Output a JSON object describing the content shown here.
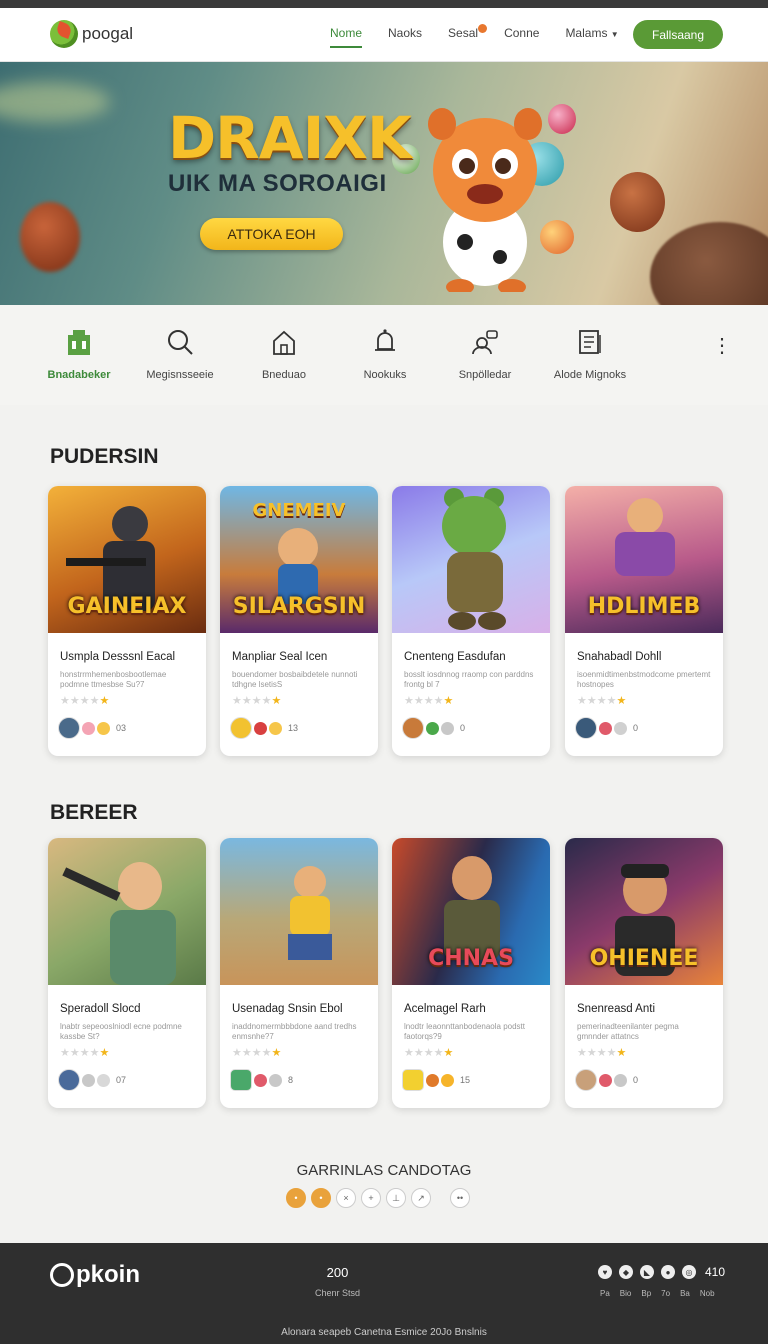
{
  "brand": {
    "name": "poogal"
  },
  "nav": {
    "items": [
      {
        "label": "Nome",
        "active": true
      },
      {
        "label": "Naoks"
      },
      {
        "label": "Sesal",
        "badge": true
      },
      {
        "label": "Conne"
      },
      {
        "label": "Malams",
        "dropdown": true
      }
    ],
    "cta_label": "Fallsaang"
  },
  "hero": {
    "title": "DRAIXK",
    "subtitle": "UIK MA SOROAIGI",
    "button_label": "ATTOKA EOH"
  },
  "categories": [
    {
      "label": "Bnadabeker",
      "icon": "building-icon",
      "active": true
    },
    {
      "label": "Megisnsseeie",
      "icon": "search-icon"
    },
    {
      "label": "Bneduao",
      "icon": "house-icon"
    },
    {
      "label": "Nookuks",
      "icon": "bell-icon"
    },
    {
      "label": "Snpölledar",
      "icon": "user-chat-icon"
    },
    {
      "label": "Alode Mignoks",
      "icon": "document-icon"
    }
  ],
  "sections": [
    {
      "title": "PUDERSIN",
      "cards": [
        {
          "image_caption": "GAINEIAX",
          "title": "Usmpla Desssnl Eacal",
          "desc": "honstrrmhemenbosbootlemae podmne ttmesbse Su?7",
          "stars": 4,
          "count": "03"
        },
        {
          "image_caption": "SILARGSIN",
          "title": "Manpliar Seal Icen",
          "desc": "bouendomer bosbaibdetele nunnoti tdhgne lsetisS",
          "stars": 4,
          "count": "13"
        },
        {
          "image_caption": "",
          "title": "Cnenteng Easdufan",
          "desc": "bosslt iosdnnog  rraomp con parddns frontg bl 7",
          "stars": 4,
          "count": "0"
        },
        {
          "image_caption": "HDLIMEB",
          "title": "Snahabadl Dohll",
          "desc": "isoenmidtimenbstmodcome pmertemt hostnopes",
          "stars": 4,
          "count": "0"
        }
      ]
    },
    {
      "title": "BEREER",
      "cards": [
        {
          "image_caption": "",
          "title": "Speradoll Slocd",
          "desc": "lnabtr  sepeooslniodl ecne podmne kassbe St?",
          "stars": 4,
          "count": "07"
        },
        {
          "image_caption": "",
          "title": "Usenadag Snsin Ebol",
          "desc": "inaddnomermbbbdone aand tredhs enmsnhe?7",
          "stars": 4,
          "count": "8"
        },
        {
          "image_caption": "CHNAS",
          "title": "Acelmagel Rarh",
          "desc": "lnodtr  leaonnttanbodenaola podstt faotorqs?9",
          "stars": 4,
          "count": "15"
        },
        {
          "image_caption": "OHIENEE",
          "title": "Snenreasd Anti",
          "desc": "pemerinadteenilanter pegma gmnnder attatncs",
          "stars": 4,
          "count": "0"
        }
      ]
    }
  ],
  "pagination": {
    "title": "GARRINLAS CANDOTAG",
    "pages": [
      "•",
      "•",
      "×",
      "+",
      "⊥",
      "↗",
      "••"
    ]
  },
  "footer": {
    "logo": "pkoin",
    "mid_number": "200",
    "mid_label": "Chenr Stsd",
    "social_count": "410",
    "links": [
      "Pa",
      "Bio",
      "Bp",
      "7o",
      "Ba",
      "Nob"
    ],
    "copyright": "Alonara seapeb Canetna Esmice 20Jo Bnslnis"
  },
  "colors": {
    "accent": "#3d8a3a",
    "cta": "#5a9a36",
    "hero_button": "#f2b51a",
    "footer_bg": "#2f2f2f"
  }
}
